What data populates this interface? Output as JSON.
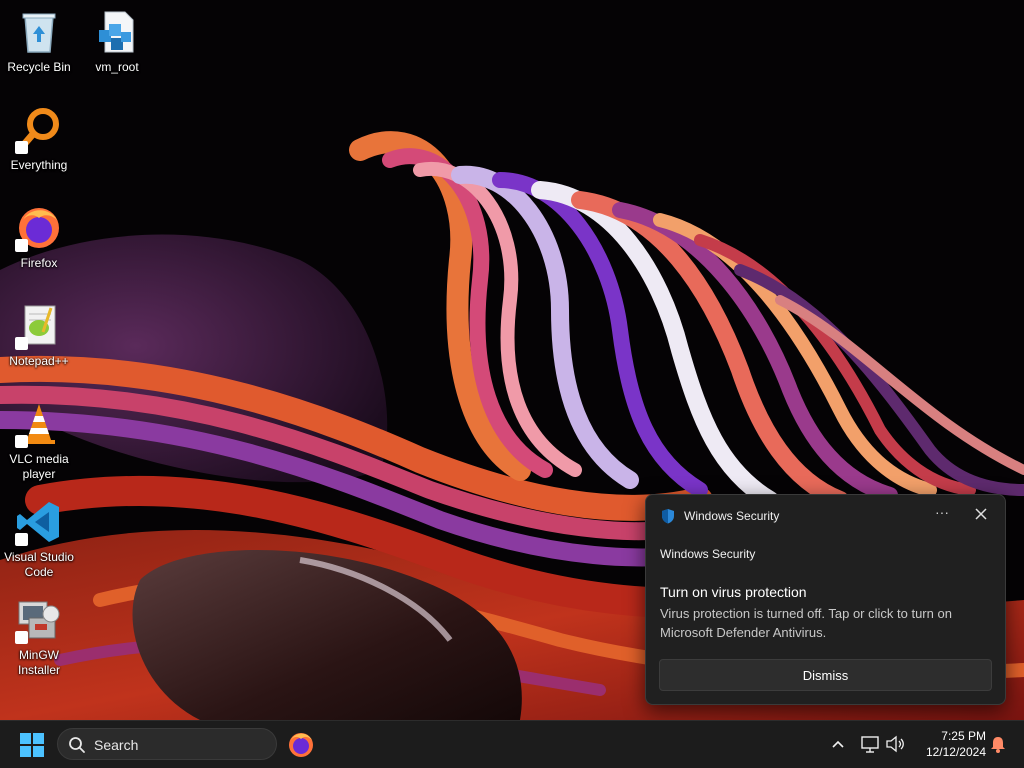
{
  "desktop": {
    "icons": [
      {
        "label": "Recycle Bin",
        "icon": "recycle-bin-icon"
      },
      {
        "label": "vm_root",
        "icon": "file-icon"
      },
      {
        "label": "Everything",
        "icon": "everything-search-icon"
      },
      {
        "label": "Firefox",
        "icon": "firefox-icon"
      },
      {
        "label": "Notepad++",
        "icon": "notepad-plus-plus-icon"
      },
      {
        "label": "VLC media player",
        "icon": "vlc-cone-icon"
      },
      {
        "label": "Visual Studio Code",
        "icon": "vscode-icon"
      },
      {
        "label": "MinGW Installer",
        "icon": "mingw-installer-icon"
      }
    ]
  },
  "toast": {
    "app_name": "Windows Security",
    "source": "Windows Security",
    "title": "Turn on virus protection",
    "body": "Virus protection is turned off. Tap or click to turn on Microsoft Defender Antivirus.",
    "dismiss_label": "Dismiss",
    "more_label": "···"
  },
  "taskbar": {
    "search_label": "Search",
    "time": "7:25 PM",
    "date": "12/12/2024"
  },
  "colors": {
    "accent": "#0078d4",
    "taskbar": "#1c1c1c",
    "toast_bg": "#202020"
  }
}
